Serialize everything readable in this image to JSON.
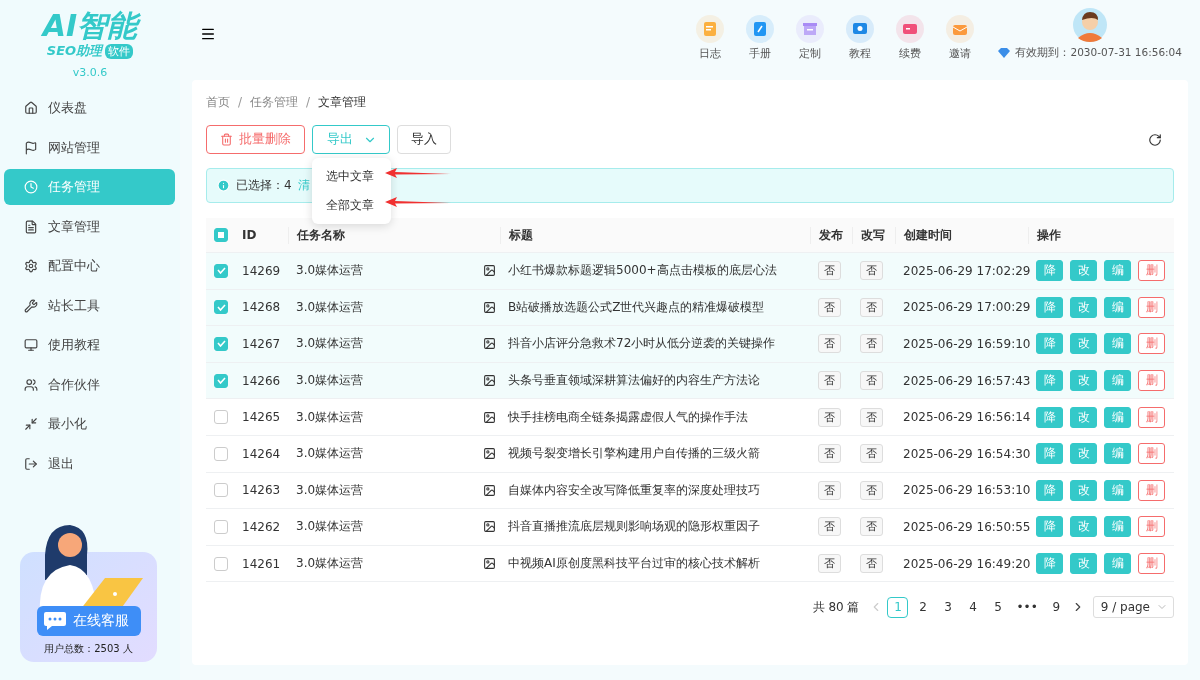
{
  "sidebar": {
    "logo": {
      "title": "AI智能",
      "subtitle": "SEO助理",
      "badge": "软件"
    },
    "version": "v3.0.6",
    "items": [
      {
        "label": "仪表盘",
        "selected": false
      },
      {
        "label": "网站管理",
        "selected": false
      },
      {
        "label": "任务管理",
        "selected": true
      },
      {
        "label": "文章管理",
        "selected": false
      },
      {
        "label": "配置中心",
        "selected": false
      },
      {
        "label": "站长工具",
        "selected": false
      },
      {
        "label": "使用教程",
        "selected": false
      },
      {
        "label": "合作伙伴",
        "selected": false
      },
      {
        "label": "最小化",
        "selected": false
      },
      {
        "label": "退出",
        "selected": false
      }
    ],
    "support": {
      "button": "在线客服",
      "users": "用户总数：2503 人"
    }
  },
  "header": {
    "shortcuts": [
      {
        "label": "日志",
        "color": "#fbb040"
      },
      {
        "label": "手册",
        "color": "#2196f3"
      },
      {
        "label": "定制",
        "color": "#a98bf5"
      },
      {
        "label": "教程",
        "color": "#1e88e5"
      },
      {
        "label": "续费",
        "color": "#f0507a"
      },
      {
        "label": "邀请",
        "color": "#fb9a3e"
      }
    ],
    "expiry": "有效期到：2030-07-31 16:56:04"
  },
  "breadcrumb": [
    {
      "label": "首页"
    },
    {
      "separator": "/",
      "label": "任务管理"
    },
    {
      "separator": "/",
      "label": "文章管理"
    }
  ],
  "toolbar": {
    "delete": "批量删除",
    "export": "导出",
    "import": "导入"
  },
  "export_menu": {
    "expanded": true,
    "items": [
      "选中文章",
      "全部文章"
    ]
  },
  "alert": {
    "selected": "已选择：4",
    "clear": "清"
  },
  "table": {
    "select_all_partial": true,
    "columns": [
      "ID",
      "任务名称",
      "标题",
      "发布",
      "改写",
      "创建时间",
      "操作"
    ],
    "rows": [
      {
        "checked": true,
        "id": "14269",
        "task": "3.0媒体运营",
        "title": "小红书爆款标题逻辑5000+高点击模板的底层心法",
        "publish": "否",
        "rewrite": "否",
        "time": "2025-06-29 17:02:29",
        "actions": [
          "降",
          "改",
          "编",
          "删"
        ]
      },
      {
        "checked": true,
        "id": "14268",
        "task": "3.0媒体运营",
        "title": "B站破播放选题公式Z世代兴趣点的精准爆破模型",
        "publish": "否",
        "rewrite": "否",
        "time": "2025-06-29 17:00:29",
        "actions": [
          "降",
          "改",
          "编",
          "删"
        ]
      },
      {
        "checked": true,
        "id": "14267",
        "task": "3.0媒体运营",
        "title": "抖音小店评分急救术72小时从低分逆袭的关键操作",
        "publish": "否",
        "rewrite": "否",
        "time": "2025-06-29 16:59:10",
        "actions": [
          "降",
          "改",
          "编",
          "删"
        ]
      },
      {
        "checked": true,
        "id": "14266",
        "task": "3.0媒体运营",
        "title": "头条号垂直领域深耕算法偏好的内容生产方法论",
        "publish": "否",
        "rewrite": "否",
        "time": "2025-06-29 16:57:43",
        "actions": [
          "降",
          "改",
          "编",
          "删"
        ]
      },
      {
        "checked": false,
        "id": "14265",
        "task": "3.0媒体运营",
        "title": "快手挂榜电商全链条揭露虚假人气的操作手法",
        "publish": "否",
        "rewrite": "否",
        "time": "2025-06-29 16:56:14",
        "actions": [
          "降",
          "改",
          "编",
          "删"
        ]
      },
      {
        "checked": false,
        "id": "14264",
        "task": "3.0媒体运营",
        "title": "视频号裂变增长引擎构建用户自传播的三级火箭",
        "publish": "否",
        "rewrite": "否",
        "time": "2025-06-29 16:54:30",
        "actions": [
          "降",
          "改",
          "编",
          "删"
        ]
      },
      {
        "checked": false,
        "id": "14263",
        "task": "3.0媒体运营",
        "title": "自媒体内容安全改写降低重复率的深度处理技巧",
        "publish": "否",
        "rewrite": "否",
        "time": "2025-06-29 16:53:10",
        "actions": [
          "降",
          "改",
          "编",
          "删"
        ]
      },
      {
        "checked": false,
        "id": "14262",
        "task": "3.0媒体运营",
        "title": "抖音直播推流底层规则影响场观的隐形权重因子",
        "publish": "否",
        "rewrite": "否",
        "time": "2025-06-29 16:50:55",
        "actions": [
          "降",
          "改",
          "编",
          "删"
        ]
      },
      {
        "checked": false,
        "id": "14261",
        "task": "3.0媒体运营",
        "title": "中视频AI原创度黑科技平台过审的核心技术解析",
        "publish": "否",
        "rewrite": "否",
        "time": "2025-06-29 16:49:20",
        "actions": [
          "降",
          "改",
          "编",
          "删"
        ]
      }
    ]
  },
  "pagination": {
    "total": "共 80 篇",
    "pages": [
      {
        "label": "1",
        "selected": true
      },
      {
        "label": "2",
        "selected": false
      },
      {
        "label": "3",
        "selected": false
      },
      {
        "label": "4",
        "selected": false
      },
      {
        "label": "5",
        "selected": false
      },
      {
        "label": "•••",
        "selected": false
      },
      {
        "label": "9",
        "selected": false
      }
    ],
    "prev_disabled": true,
    "page_size": "9 / page"
  }
}
